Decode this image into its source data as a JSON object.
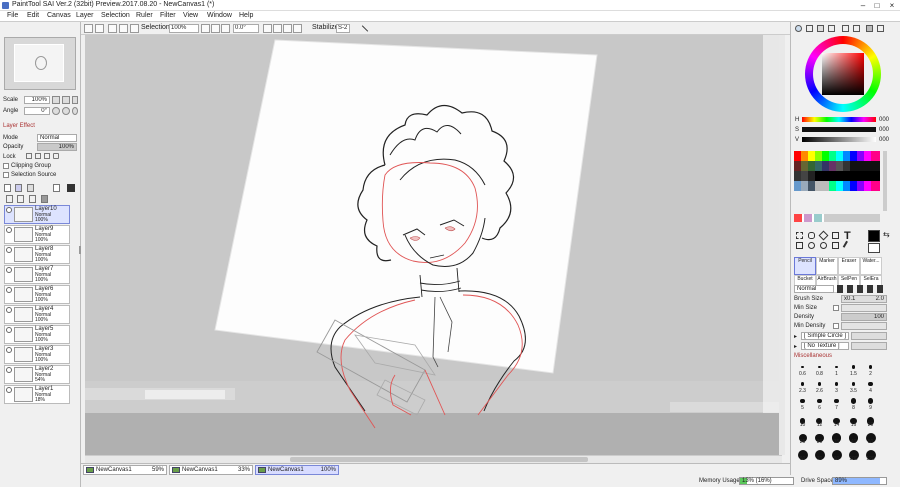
{
  "window": {
    "title": "PaintTool SAI Ver.2 (32bit) Preview.2017.08.20 - NewCanvas1 (*)"
  },
  "menu": [
    "File",
    "Edit",
    "Canvas",
    "Layer",
    "Selection",
    "Ruler",
    "Filter",
    "View",
    "Window",
    "Help"
  ],
  "toolbar": {
    "selection_label": "Selection",
    "zoom": "100%",
    "angle": "0.0°",
    "stabilizer_label": "Stabilizer",
    "stabilizer_value": "S-2"
  },
  "nav": {
    "scale_label": "Scale",
    "scale_value": "100%",
    "angle_label": "Angle",
    "angle_value": "0°"
  },
  "layer_effect": "Layer Effect",
  "layer_props": {
    "mode_label": "Mode",
    "mode_value": "Normal",
    "opacity_label": "Opacity",
    "opacity_value": "100%",
    "lock_label": "Lock",
    "clipping_label": "Clipping Group",
    "selection_source_label": "Selection Source"
  },
  "layers": [
    {
      "name": "Layer10",
      "mode": "Normal",
      "opacity": "100%",
      "selected": true
    },
    {
      "name": "Layer9",
      "mode": "Normal",
      "opacity": "100%"
    },
    {
      "name": "Layer8",
      "mode": "Normal",
      "opacity": "100%"
    },
    {
      "name": "Layer7",
      "mode": "Normal",
      "opacity": "100%"
    },
    {
      "name": "Layer6",
      "mode": "Normal",
      "opacity": "100%"
    },
    {
      "name": "Layer4",
      "mode": "Normal",
      "opacity": "100%"
    },
    {
      "name": "Layer5",
      "mode": "Normal",
      "opacity": "100%"
    },
    {
      "name": "Layer3",
      "mode": "Normal",
      "opacity": "100%"
    },
    {
      "name": "Layer2",
      "mode": "Normal",
      "opacity": "54%"
    },
    {
      "name": "Layer1",
      "mode": "Normal",
      "opacity": "18%"
    }
  ],
  "canvas_tabs": [
    {
      "name": "NewCanvas1",
      "zoom": "59%"
    },
    {
      "name": "NewCanvas1",
      "zoom": "33%"
    },
    {
      "name": "NewCanvas1",
      "zoom": "100%",
      "selected": true
    }
  ],
  "status": {
    "memory_label": "Memory Usage",
    "memory_value": "13% (16%)",
    "memory_fill": 0.13,
    "drive_label": "Drive Space",
    "drive_value": "89%",
    "drive_fill": 0.89
  },
  "color": {
    "h_label": "H",
    "s_label": "S",
    "v_label": "V",
    "h_value": "000",
    "s_value": "000",
    "v_value": "000",
    "foreground": "#000000",
    "background": "#ffffff"
  },
  "tools": [
    {
      "name": "Pencil",
      "selected": true
    },
    {
      "name": "Marker"
    },
    {
      "name": "Eraser"
    },
    {
      "name": "Water..."
    },
    {
      "name": "Bucket"
    },
    {
      "name": "AirBrush"
    },
    {
      "name": "SelPen"
    },
    {
      "name": "SelEra"
    }
  ],
  "brush": {
    "mode": "Normal",
    "size_label": "Brush Size",
    "size_mult": "x0.1",
    "size_value": "2.0",
    "min_size_label": "Min Size",
    "min_size_value": "",
    "density_label": "Density",
    "density_value": "100",
    "min_density_label": "Min Density",
    "min_density_value": "",
    "shape": "[ Simple Circle ]",
    "texture": "[ No Texture ]",
    "misc_label": "Miscellaneous"
  },
  "brush_sizes": [
    "0.6",
    "0.8",
    "1",
    "1.5",
    "2",
    "2.3",
    "2.6",
    "3",
    "3.5",
    "4",
    "5",
    "6",
    "7",
    "8",
    "9",
    "10",
    "12",
    "14",
    "16",
    "20",
    "25",
    "30",
    "35",
    "40",
    "50",
    "60",
    "70",
    "80",
    "100",
    "120"
  ],
  "accent_colors": {
    "selection": "#dde3ff",
    "memory_bar": "#5ac85a",
    "drive_bar": "#8fb8ff"
  }
}
